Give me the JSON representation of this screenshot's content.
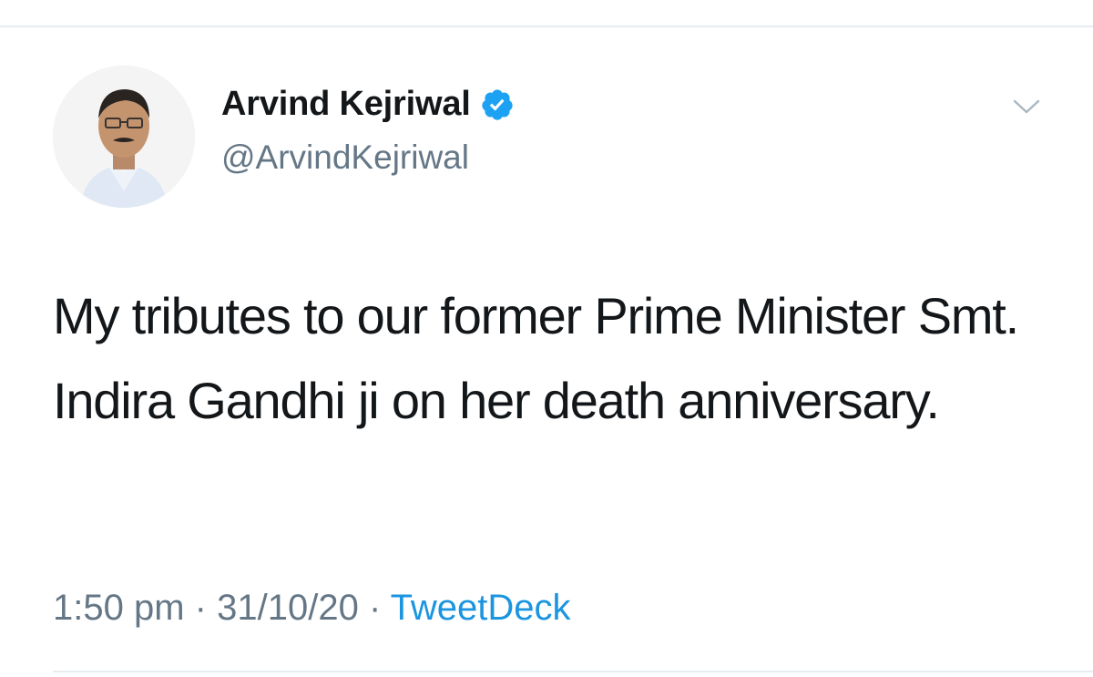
{
  "tweet": {
    "author": {
      "display_name": "Arvind Kejriwal",
      "handle": "@ArvindKejriwal",
      "verified": true
    },
    "text": "My tributes to our former Prime Minister Smt. Indira Gandhi ji on her death anniversary.",
    "time": "1:50 pm",
    "separator": "·",
    "date": "31/10/20",
    "source": "TweetDeck"
  },
  "icons": {
    "verified": "verified-badge-icon",
    "more": "chevron-down-icon"
  },
  "colors": {
    "text": "#14171a",
    "secondary": "#657786",
    "link": "#1b95e0",
    "verified": "#1da1f2",
    "divider": "#e6ecf0"
  }
}
